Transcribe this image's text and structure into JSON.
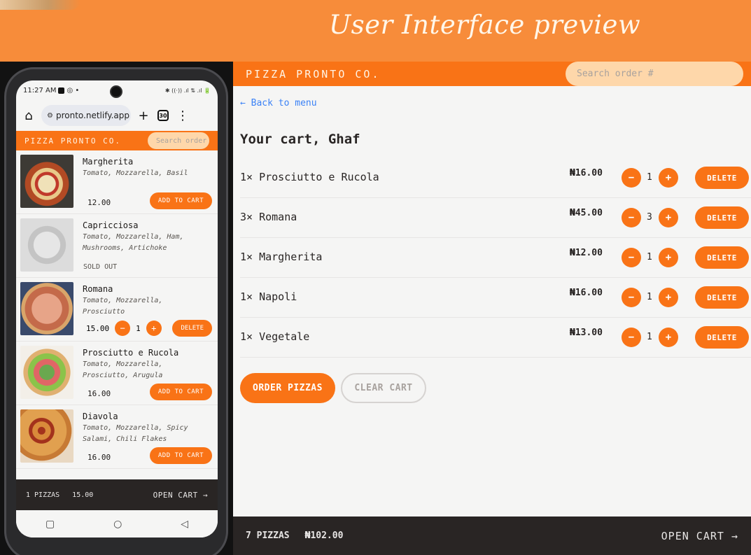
{
  "banner": {
    "title": "User Interface preview"
  },
  "phone": {
    "status": {
      "time": "11:27 AM",
      "icons": "✱ ((·)) .ıl ⇅ .ıl 🔋"
    },
    "browser": {
      "url": "pronto.netlify.app",
      "tab_count": "30"
    },
    "header": {
      "brand": "PIZZA PRONTO CO.",
      "search_placeholder": "Search order #"
    },
    "menu": [
      {
        "name": "Margherita",
        "ingredients": "Tomato, Mozzarella, Basil",
        "price": "12.00",
        "action": "ADD TO CART"
      },
      {
        "name": "Capricciosa",
        "ingredients": "Tomato, Mozzarella, Ham, Mushrooms, Artichoke",
        "status": "SOLD OUT"
      },
      {
        "name": "Romana",
        "ingredients": "Tomato, Mozzarella, Prosciutto",
        "price": "15.00",
        "qty": "1",
        "action": "DELETE"
      },
      {
        "name": "Prosciutto e Rucola",
        "ingredients": "Tomato, Mozzarella, Prosciutto, Arugula",
        "price": "16.00",
        "action": "ADD TO CART"
      },
      {
        "name": "Diavola",
        "ingredients": "Tomato, Mozzarella, Spicy Salami, Chili Flakes",
        "price": "16.00",
        "action": "ADD TO CART"
      }
    ],
    "footer": {
      "count": "1 PIZZAS",
      "total": "15.00",
      "open": "OPEN CART →"
    }
  },
  "desktop": {
    "header": {
      "brand": "PIZZA PRONTO CO.",
      "search_placeholder": "Search order #"
    },
    "back": "← Back to menu",
    "title": "Your cart, Ghaf",
    "cart": [
      {
        "name": "1× Prosciutto e Rucola",
        "price": "₦16.00",
        "qty": "1"
      },
      {
        "name": "3× Romana",
        "price": "₦45.00",
        "qty": "3"
      },
      {
        "name": "1× Margherita",
        "price": "₦12.00",
        "qty": "1"
      },
      {
        "name": "1× Napoli",
        "price": "₦16.00",
        "qty": "1"
      },
      {
        "name": "1× Vegetale",
        "price": "₦13.00",
        "qty": "1"
      }
    ],
    "buttons": {
      "minus": "−",
      "plus": "+",
      "delete": "DELETE",
      "order": "ORDER PIZZAS",
      "clear": "CLEAR CART"
    },
    "footer": {
      "count": "7 PIZZAS",
      "total": "₦102.00",
      "open": "OPEN CART →"
    }
  }
}
